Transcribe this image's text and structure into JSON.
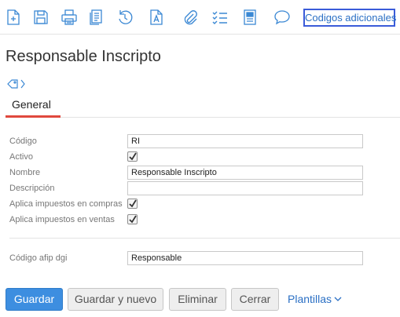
{
  "toolbar": {
    "icons": [
      "new-document-icon",
      "save-icon",
      "print-icon",
      "copy-icon",
      "history-icon",
      "document-text-icon",
      "attachment-icon",
      "checklist-icon",
      "report-icon",
      "comment-icon"
    ],
    "codigos_label": "Codigos adicionales",
    "accent_color": "#3a5bd9"
  },
  "page": {
    "title": "Responsable Inscripto"
  },
  "tabs": [
    {
      "label": "General",
      "active": true
    }
  ],
  "form": {
    "codigo": {
      "label": "Código",
      "value": "RI"
    },
    "activo": {
      "label": "Activo",
      "checked": true
    },
    "nombre": {
      "label": "Nombre",
      "value": "Responsable Inscripto"
    },
    "descripcion": {
      "label": "Descripción",
      "value": ""
    },
    "aplica_compras": {
      "label": "Aplica impuestos en compras",
      "checked": true
    },
    "aplica_ventas": {
      "label": "Aplica impuestos en ventas",
      "checked": true
    },
    "codigo_afip": {
      "label": "Código afip dgi",
      "value": "Responsable"
    }
  },
  "buttons": {
    "guardar": "Guardar",
    "guardar_nuevo": "Guardar y nuevo",
    "eliminar": "Eliminar",
    "cerrar": "Cerrar",
    "plantillas": "Plantillas"
  },
  "colors": {
    "primary": "#3d8ee0",
    "tab_active": "#e0483d",
    "link": "#2a6fc4"
  }
}
